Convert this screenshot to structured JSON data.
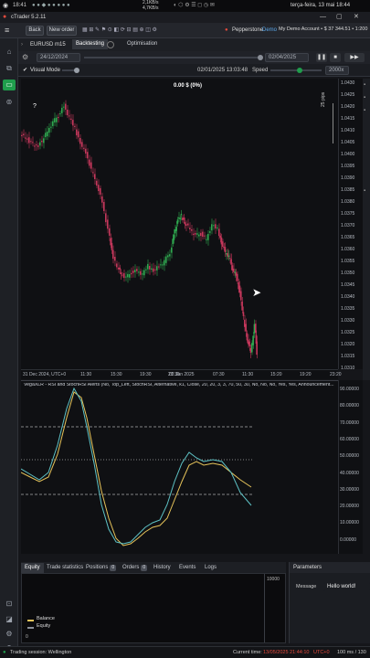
{
  "os_bar": {
    "time": "18:41",
    "net_up": "2,1KB/s",
    "net_down": "4,7KB/s",
    "datetime": "terça-feira, 13 mai 18:44"
  },
  "window": {
    "title": "cTrader 5.2.11"
  },
  "toolbar": {
    "back_label": "Back",
    "new_order_label": "New order",
    "broker": "Pepperstone",
    "mode": "Demo",
    "account": "My Demo Account • $ 37 344.51 • 1:200"
  },
  "tabs": {
    "symbol": "EURUSD",
    "timeframe": "m15",
    "backtesting": "Backtesting",
    "optimisation": "Optimisation"
  },
  "dates": {
    "start": "24/12/2024",
    "end": "02/04/2025"
  },
  "visual_row": {
    "visual_mode_label": "Visual Mode",
    "datetime": "02/01/2025 13:03:48",
    "speed_label": "Speed",
    "speed_value": "2000x"
  },
  "chart": {
    "pnl_label": "0.00 $ (0%)",
    "help_label": "?",
    "pips_label": "25 pips",
    "price_ticks": [
      "1.0430",
      "1.0425",
      "1.0420",
      "1.0415",
      "1.0410",
      "1.0405",
      "1.0400",
      "1.0395",
      "1.0390",
      "1.0385",
      "1.0380",
      "1.0375",
      "1.0370",
      "1.0365",
      "1.0360",
      "1.0355",
      "1.0350",
      "1.0345",
      "1.0340",
      "1.0335",
      "1.0330",
      "1.0325",
      "1.0320",
      "1.0315",
      "1.0310"
    ],
    "time_ticks": [
      "31 Dec 2024, UTC+0",
      "11:30",
      "15:30",
      "19:30",
      "23:30",
      "02 Jan 2025",
      "07:30",
      "11:30",
      "15:20",
      "19:20",
      "23:20"
    ],
    "colors": {
      "bull": "#2fa84f",
      "bear": "#c4375b",
      "background": "#0f1013"
    }
  },
  "indicator": {
    "title": "VegaXLR - RSI and StochRSI Alerts (No, Top_Left, StochRSI, Alternative, k1, Close, 20, 20, 3, 3, 70, 50, 30, No, No, No, Yes, Yes, Announcement...",
    "ticks": [
      "90.00000",
      "80.00000",
      "70.00000",
      "60.00000",
      "50.00000",
      "40.00000",
      "30.00000",
      "20.00000",
      "10.00000",
      "0.00000"
    ],
    "colors": {
      "k_line": "#e6c35a",
      "d_line": "#5ec3c6"
    }
  },
  "bottom_tabs": [
    {
      "label": "Equity",
      "badge": ""
    },
    {
      "label": "Trade statistics",
      "badge": ""
    },
    {
      "label": "Positions",
      "badge": "0"
    },
    {
      "label": "Orders",
      "badge": "0"
    },
    {
      "label": "History",
      "badge": ""
    },
    {
      "label": "Events",
      "badge": ""
    },
    {
      "label": "Logs",
      "badge": ""
    }
  ],
  "equity": {
    "max_tick": "10000",
    "min_tick": "0",
    "legend_balance": "Balance",
    "legend_equity": "Equity",
    "colors": {
      "balance": "#e6c35a",
      "equity": "#8a8f98"
    }
  },
  "parameters": {
    "title": "Parameters",
    "message_label": "Message",
    "message_value": "Hello world!"
  },
  "status": {
    "session": "Trading session: Wellington",
    "current_time_label": "Current time:",
    "current_time": "13/05/2025 21:44:10",
    "tz": "UTC+0",
    "speed": "100 ms / 130"
  }
}
